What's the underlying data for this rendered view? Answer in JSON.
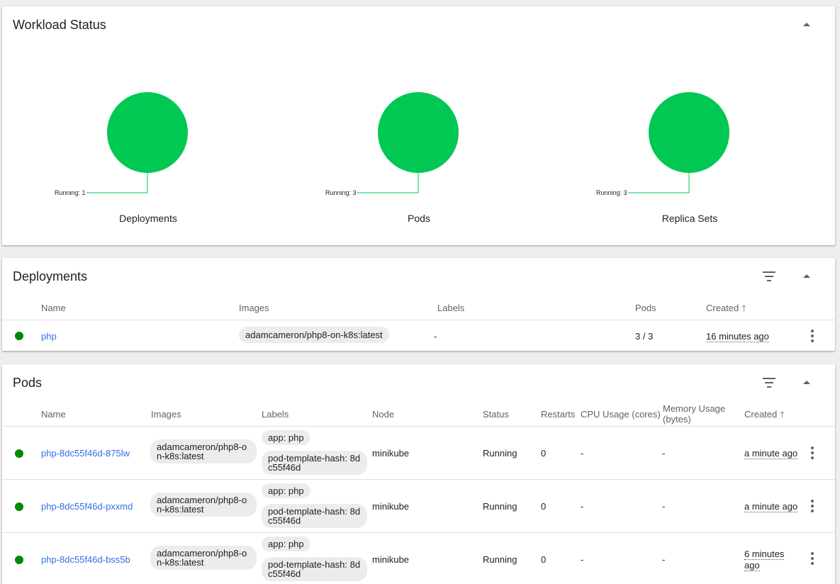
{
  "workload": {
    "title": "Workload Status",
    "items": [
      {
        "caption": "Deployments",
        "legend": "Running: 1",
        "running": 1
      },
      {
        "caption": "Pods",
        "legend": "Running: 3",
        "running": 3
      },
      {
        "caption": "Replica Sets",
        "legend": "Running: 3",
        "running": 3
      }
    ],
    "running_color": "#00c853"
  },
  "deployments": {
    "title": "Deployments",
    "headers": {
      "name": "Name",
      "images": "Images",
      "labels": "Labels",
      "pods": "Pods",
      "created": "Created"
    },
    "rows": [
      {
        "name": "php",
        "image": "adamcameron/php8-on-k8s:latest",
        "labels": "-",
        "pods": "3 / 3",
        "created": "16 minutes ago"
      }
    ]
  },
  "pods": {
    "title": "Pods",
    "headers": {
      "name": "Name",
      "images": "Images",
      "labels": "Labels",
      "node": "Node",
      "status": "Status",
      "restarts": "Restarts",
      "cpu": "CPU Usage (cores)",
      "memory_line1": "Memory Usage",
      "memory_line2": "(bytes)",
      "created": "Created"
    },
    "rows": [
      {
        "name": "php-8dc55f46d-875lw",
        "image_line1": "adamcameron/php8-o",
        "image_line2": "n-k8s:latest",
        "label1": "app: php",
        "label2_line1": "pod-template-hash: 8d",
        "label2_line2": "c55f46d",
        "node": "minikube",
        "status": "Running",
        "restarts": "0",
        "cpu": "-",
        "memory": "-",
        "created_line1": "a minute ago",
        "created_line2": ""
      },
      {
        "name": "php-8dc55f46d-pxxmd",
        "image_line1": "adamcameron/php8-o",
        "image_line2": "n-k8s:latest",
        "label1": "app: php",
        "label2_line1": "pod-template-hash: 8d",
        "label2_line2": "c55f46d",
        "node": "minikube",
        "status": "Running",
        "restarts": "0",
        "cpu": "-",
        "memory": "-",
        "created_line1": "a minute ago",
        "created_line2": ""
      },
      {
        "name": "php-8dc55f46d-bss5b",
        "image_line1": "adamcameron/php8-o",
        "image_line2": "n-k8s:latest",
        "label1": "app: php",
        "label2_line1": "pod-template-hash: 8d",
        "label2_line2": "c55f46d",
        "node": "minikube",
        "status": "Running",
        "restarts": "0",
        "cpu": "-",
        "memory": "-",
        "created_line1": "6 minutes",
        "created_line2": "ago"
      }
    ]
  },
  "icons": {
    "collapse": "chevron-up-icon",
    "filter": "filter-icon",
    "more": "more-vert-icon",
    "sort": "arrow-upward-icon",
    "status": "status-running-icon"
  },
  "colors": {
    "link": "#326de6",
    "status_ok": "#008a00",
    "running_green": "#00c853"
  }
}
